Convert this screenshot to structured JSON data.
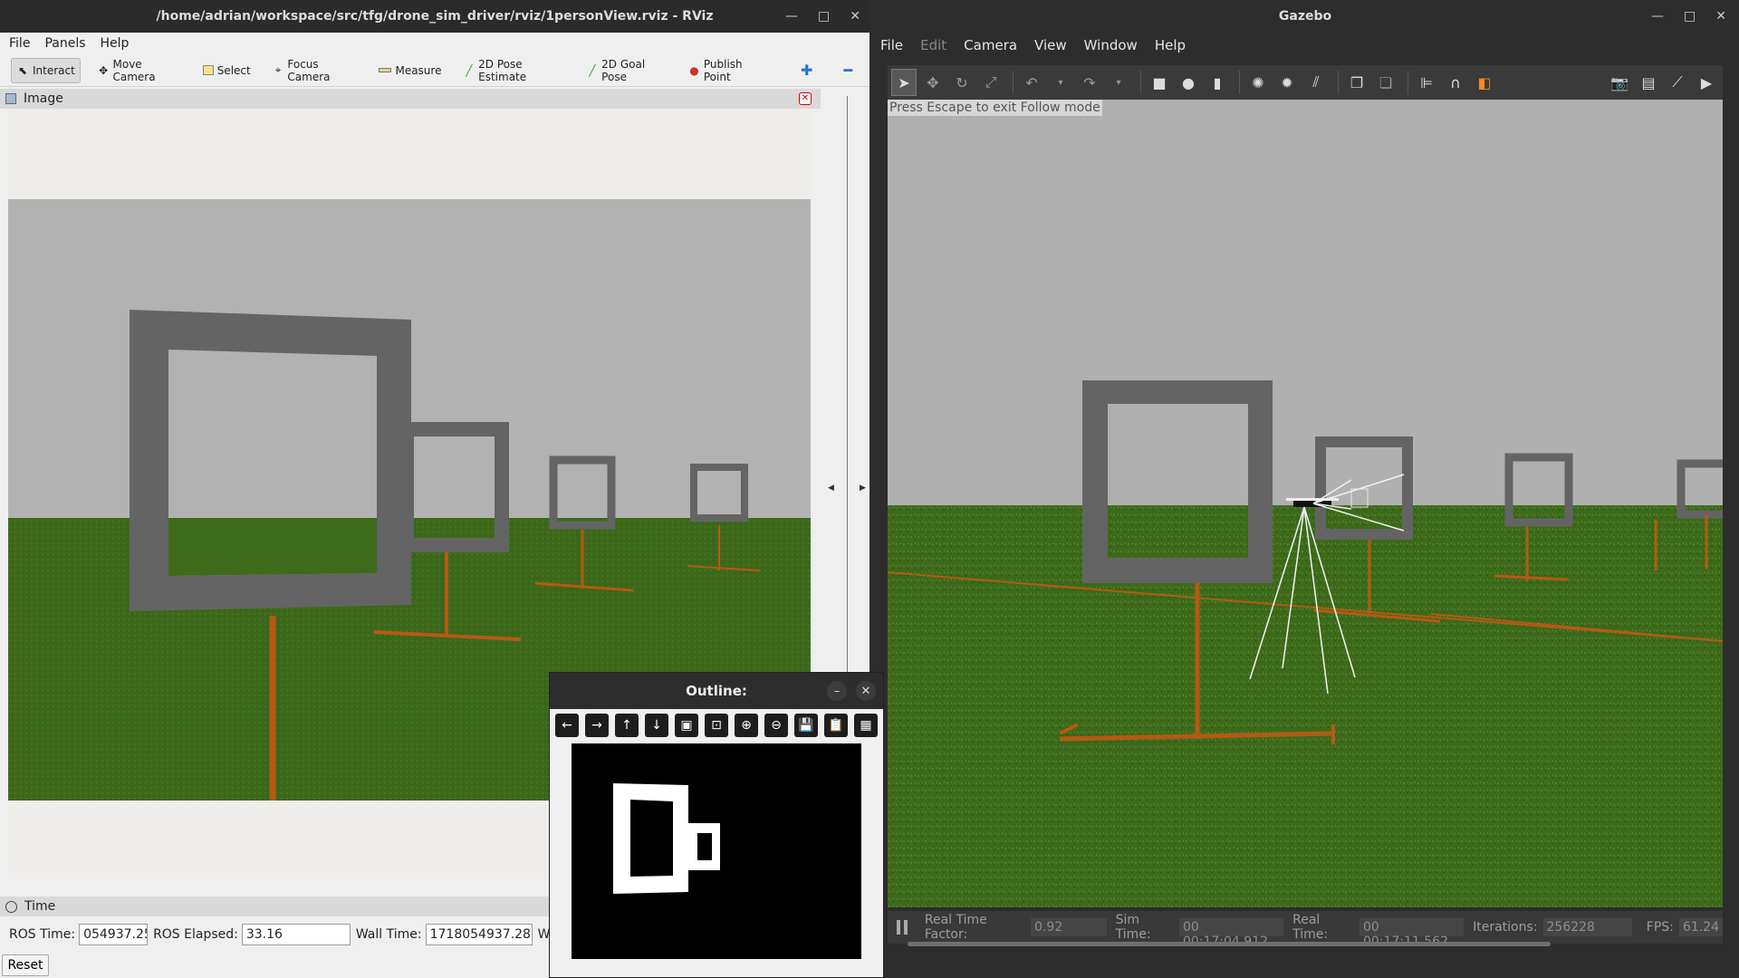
{
  "rviz": {
    "title": "/home/adrian/workspace/src/tfg/drone_sim_driver/rviz/1personView.rviz - RViz",
    "menu": [
      "File",
      "Panels",
      "Help"
    ],
    "tools": [
      {
        "label": "Interact",
        "icon": "cursor-icon",
        "active": true
      },
      {
        "label": "Move Camera",
        "icon": "move-camera-icon"
      },
      {
        "label": "Select",
        "icon": "select-box-icon"
      },
      {
        "label": "Focus Camera",
        "icon": "focus-camera-icon"
      },
      {
        "label": "Measure",
        "icon": "ruler-icon"
      },
      {
        "label": "2D Pose Estimate",
        "icon": "green-arrow-icon"
      },
      {
        "label": "2D Goal Pose",
        "icon": "green-arrow-icon"
      },
      {
        "label": "Publish Point",
        "icon": "map-pin-icon"
      }
    ],
    "image_panel": {
      "title": "Image"
    },
    "time_panel": {
      "title": "Time",
      "ros_time_label": "ROS Time:",
      "ros_time_value": "054937.25",
      "ros_elapsed_label": "ROS Elapsed:",
      "ros_elapsed_value": "33.16",
      "wall_time_label": "Wall Time:",
      "wall_time_value": "1718054937.28",
      "wall_elapsed_label": "W",
      "reset_label": "Reset"
    }
  },
  "gazebo": {
    "title": "Gazebo",
    "menu": [
      "File",
      "Edit",
      "Camera",
      "View",
      "Window",
      "Help"
    ],
    "menu_disabled": [
      "Edit"
    ],
    "follow_message": "Press Escape to exit Follow mode",
    "status": {
      "real_time_factor_label": "Real Time Factor:",
      "real_time_factor_value": "0.92",
      "sim_time_label": "Sim Time:",
      "sim_time_value": "00 00:17:04.912",
      "real_time_label": "Real Time:",
      "real_time_value": "00 00:17:11.562",
      "iterations_label": "Iterations:",
      "iterations_value": "256228",
      "fps_label": "FPS:",
      "fps_value": "61.24"
    }
  },
  "outline_window": {
    "title": "Outline:"
  },
  "colors": {
    "sky": "#b0b0b0",
    "ground": "#3f6b1c",
    "frame": "#646464",
    "pole": "#b55a14"
  }
}
